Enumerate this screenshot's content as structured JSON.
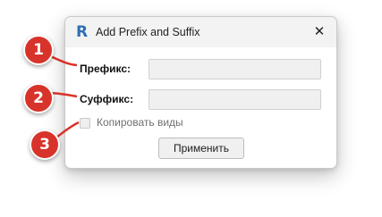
{
  "window": {
    "title": "Add Prefix and Suffix",
    "app_icon": "R",
    "close_glyph": "✕"
  },
  "form": {
    "prefix_label": "Префикс:",
    "prefix_value": "",
    "suffix_label": "Суффикс:",
    "suffix_value": "",
    "copy_views_label": "Копировать виды",
    "copy_views_checked": false,
    "apply_label": "Применить"
  },
  "callouts": [
    {
      "number": "1"
    },
    {
      "number": "2"
    },
    {
      "number": "3"
    }
  ],
  "colors": {
    "callout": "#d8332a",
    "app_icon": "#2f6fb5"
  }
}
